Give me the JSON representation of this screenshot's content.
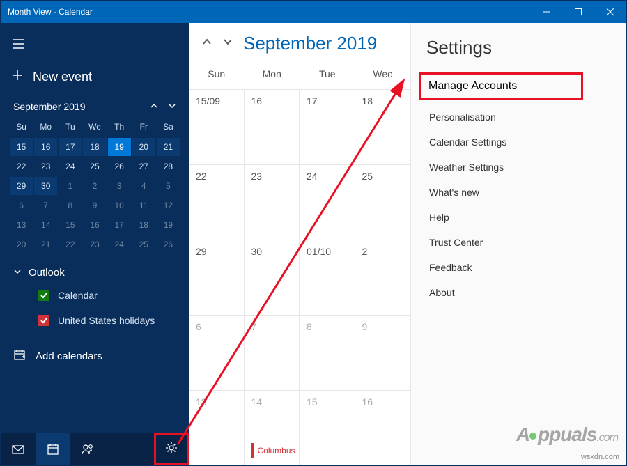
{
  "titlebar": {
    "title": "Month View - Calendar"
  },
  "sidebar": {
    "new_event": "New event",
    "mini_month": "September 2019",
    "dow": [
      "Su",
      "Mo",
      "Tu",
      "We",
      "Th",
      "Fr",
      "Sa"
    ],
    "grid": [
      {
        "n": "15",
        "cls": "week-hl"
      },
      {
        "n": "16",
        "cls": "week-hl"
      },
      {
        "n": "17",
        "cls": "week-hl"
      },
      {
        "n": "18",
        "cls": "week-hl"
      },
      {
        "n": "19",
        "cls": "today"
      },
      {
        "n": "20",
        "cls": "week-hl"
      },
      {
        "n": "21",
        "cls": "week-hl"
      },
      {
        "n": "22",
        "cls": ""
      },
      {
        "n": "23",
        "cls": ""
      },
      {
        "n": "24",
        "cls": ""
      },
      {
        "n": "25",
        "cls": ""
      },
      {
        "n": "26",
        "cls": ""
      },
      {
        "n": "27",
        "cls": ""
      },
      {
        "n": "28",
        "cls": ""
      },
      {
        "n": "29",
        "cls": "today-box"
      },
      {
        "n": "30",
        "cls": "today-box"
      },
      {
        "n": "1",
        "cls": "dim"
      },
      {
        "n": "2",
        "cls": "dim"
      },
      {
        "n": "3",
        "cls": "dim"
      },
      {
        "n": "4",
        "cls": "dim"
      },
      {
        "n": "5",
        "cls": "dim"
      },
      {
        "n": "6",
        "cls": "dim"
      },
      {
        "n": "7",
        "cls": "dim"
      },
      {
        "n": "8",
        "cls": "dim"
      },
      {
        "n": "9",
        "cls": "dim"
      },
      {
        "n": "10",
        "cls": "dim"
      },
      {
        "n": "11",
        "cls": "dim"
      },
      {
        "n": "12",
        "cls": "dim"
      },
      {
        "n": "13",
        "cls": "dim"
      },
      {
        "n": "14",
        "cls": "dim"
      },
      {
        "n": "15",
        "cls": "dim"
      },
      {
        "n": "16",
        "cls": "dim"
      },
      {
        "n": "17",
        "cls": "dim"
      },
      {
        "n": "18",
        "cls": "dim"
      },
      {
        "n": "19",
        "cls": "dim"
      },
      {
        "n": "20",
        "cls": "dim"
      },
      {
        "n": "21",
        "cls": "dim"
      },
      {
        "n": "22",
        "cls": "dim"
      },
      {
        "n": "23",
        "cls": "dim"
      },
      {
        "n": "24",
        "cls": "dim"
      },
      {
        "n": "25",
        "cls": "dim"
      },
      {
        "n": "26",
        "cls": "dim"
      }
    ],
    "account_section": "Outlook",
    "calendars": [
      {
        "label": "Calendar",
        "color": "green"
      },
      {
        "label": "United States holidays",
        "color": "red"
      }
    ],
    "add_calendars": "Add calendars"
  },
  "main": {
    "title": "September 2019",
    "dow": [
      "Sun",
      "Mon",
      "Tue",
      "Wec"
    ],
    "rows": [
      [
        {
          "t": "15/09"
        },
        {
          "t": "16"
        },
        {
          "t": "17"
        },
        {
          "t": "18"
        }
      ],
      [
        {
          "t": "22"
        },
        {
          "t": "23"
        },
        {
          "t": "24"
        },
        {
          "t": "25"
        }
      ],
      [
        {
          "t": "29"
        },
        {
          "t": "30"
        },
        {
          "t": "01/10"
        },
        {
          "t": "2"
        }
      ],
      [
        {
          "t": "6"
        },
        {
          "t": "7"
        },
        {
          "t": "8"
        },
        {
          "t": "9"
        }
      ],
      [
        {
          "t": "13"
        },
        {
          "t": "14",
          "event": "Columbus"
        },
        {
          "t": "15"
        },
        {
          "t": "16"
        }
      ]
    ]
  },
  "settings": {
    "title": "Settings",
    "items": [
      "Manage Accounts",
      "Personalisation",
      "Calendar Settings",
      "Weather Settings",
      "What's new",
      "Help",
      "Trust Center",
      "Feedback",
      "About"
    ]
  },
  "watermark": {
    "brand_a": "A",
    "brand_b": "ppuals",
    "dotcom": ".com",
    "wsxdn": "wsxdn.com"
  }
}
